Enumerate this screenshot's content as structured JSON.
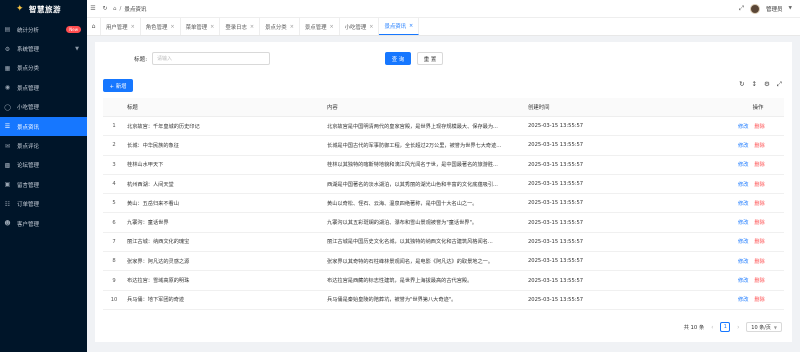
{
  "app": {
    "name": "智慧旅游"
  },
  "sidebar": {
    "items": [
      {
        "label": "统计分析",
        "icon": "chart-icon",
        "badge": "New",
        "active": false
      },
      {
        "label": "系统管理",
        "icon": "gear-icon",
        "caret": true,
        "active": false
      },
      {
        "label": "景点分类",
        "icon": "category-icon",
        "active": false
      },
      {
        "label": "景点管理",
        "icon": "location-icon",
        "active": false
      },
      {
        "label": "小吃管理",
        "icon": "food-icon",
        "active": false
      },
      {
        "label": "景点资讯",
        "icon": "news-icon",
        "active": true
      },
      {
        "label": "景点评论",
        "icon": "comment-icon",
        "active": false
      },
      {
        "label": "论坛管理",
        "icon": "forum-icon",
        "active": false
      },
      {
        "label": "留言管理",
        "icon": "message-icon",
        "active": false
      },
      {
        "label": "订单管理",
        "icon": "order-icon",
        "active": false
      },
      {
        "label": "客户管理",
        "icon": "user-icon",
        "active": false
      }
    ]
  },
  "header": {
    "breadcrumb_current": "景点资讯",
    "username": "管理员"
  },
  "tabs": [
    {
      "label": "用户管理",
      "active": false
    },
    {
      "label": "角色管理",
      "active": false
    },
    {
      "label": "菜单管理",
      "active": false
    },
    {
      "label": "登录日志",
      "active": false
    },
    {
      "label": "景点分类",
      "active": false
    },
    {
      "label": "景点管理",
      "active": false
    },
    {
      "label": "小吃管理",
      "active": false
    },
    {
      "label": "景点资讯",
      "active": true
    }
  ],
  "search": {
    "label": "标题:",
    "placeholder": "请输入",
    "query_label": "查 询",
    "reset_label": "重 置"
  },
  "toolbar": {
    "add_label": "+ 新增"
  },
  "table": {
    "columns": {
      "title": "标题",
      "content": "内容",
      "time": "创建时间",
      "op": "操作"
    },
    "edit_label": "修改",
    "delete_label": "删除",
    "rows": [
      {
        "idx": "1",
        "title": "北京故宫：千年皇城的历史印记",
        "content": "北京故宫是中国明清两代的皇家宫殿，是世界上现存规模最大、保存最为...",
        "time": "2025-03-15 13:55:57"
      },
      {
        "idx": "2",
        "title": "长城：中华民族的象征",
        "content": "长城是中国古代的军事防御工程，全长超过2万公里，被誉为世界七大奇迹...",
        "time": "2025-03-15 13:55:57"
      },
      {
        "idx": "3",
        "title": "桂林山水甲天下",
        "content": "桂林以其独特的喀斯特地貌和漓江风光闻名于世，是中国最著名的旅游胜...",
        "time": "2025-03-15 13:55:57"
      },
      {
        "idx": "4",
        "title": "杭州西湖：人间天堂",
        "content": "西湖是中国著名的淡水湖泊，以其秀丽的湖光山色和丰富的文化底蕴吸引...",
        "time": "2025-03-15 13:55:57"
      },
      {
        "idx": "5",
        "title": "黄山：五岳归来不看山",
        "content": "黄山以奇松、怪石、云海、温泉四绝著称，是中国十大名山之一。",
        "time": "2025-03-15 13:55:57"
      },
      {
        "idx": "6",
        "title": "九寨沟：童话世界",
        "content": "九寨沟以其五彩斑斓的湖泊、瀑布和雪山景观被誉为\"童话世界\"。",
        "time": "2025-03-15 13:55:57"
      },
      {
        "idx": "7",
        "title": "丽江古城：纳西文化的瑰宝",
        "content": "丽江古城是中国历史文化名城，以其独特的纳西文化和古建筑风格闻名...",
        "time": "2025-03-15 13:55:57"
      },
      {
        "idx": "8",
        "title": "张家界：阿凡达的灵感之源",
        "content": "张家界以其奇特的石柱峰林景观闻名，是电影《阿凡达》的取景地之一。",
        "time": "2025-03-15 13:55:57"
      },
      {
        "idx": "9",
        "title": "布达拉宫：雪域高原的明珠",
        "content": "布达拉宫是西藏的标志性建筑，是世界上海拔最高的古代宫殿。",
        "time": "2025-03-15 13:55:57"
      },
      {
        "idx": "10",
        "title": "兵马俑：地下军团的奇迹",
        "content": "兵马俑是秦始皇陵的陪葬坑，被誉为\"世界第八大奇迹\"。",
        "time": "2025-03-15 13:55:57"
      }
    ]
  },
  "pagination": {
    "total_label": "共 10 条",
    "current_page": "1",
    "page_size_label": "10 条/页"
  },
  "colors": {
    "primary": "#1677ff",
    "sidebar_bg": "#001529",
    "danger": "#ff4d4f"
  }
}
